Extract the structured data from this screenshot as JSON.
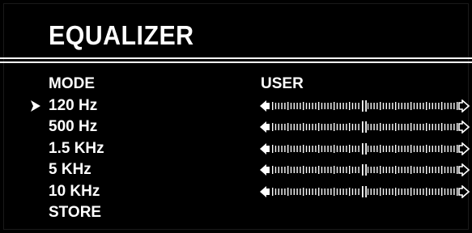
{
  "title": "EQUALIZER",
  "selected_index": 1,
  "rows": [
    {
      "label": "MODE",
      "value": "USER",
      "type": "option"
    },
    {
      "label": "120 Hz",
      "type": "slider",
      "level": 0.5
    },
    {
      "label": "500 Hz",
      "type": "slider",
      "level": 0.5
    },
    {
      "label": "1.5 KHz",
      "type": "slider",
      "level": 0.5
    },
    {
      "label": "5 KHz",
      "type": "slider",
      "level": 0.5
    },
    {
      "label": "10 KHz",
      "type": "slider",
      "level": 0.5
    },
    {
      "label": "STORE",
      "type": "action"
    }
  ],
  "icons": {
    "cursor": "right-pointer-arrow-icon",
    "slider_left": "left-arrow-icon",
    "slider_right": "right-arrow-icon"
  },
  "colors": {
    "background": "#000000",
    "foreground": "#ffffff"
  }
}
